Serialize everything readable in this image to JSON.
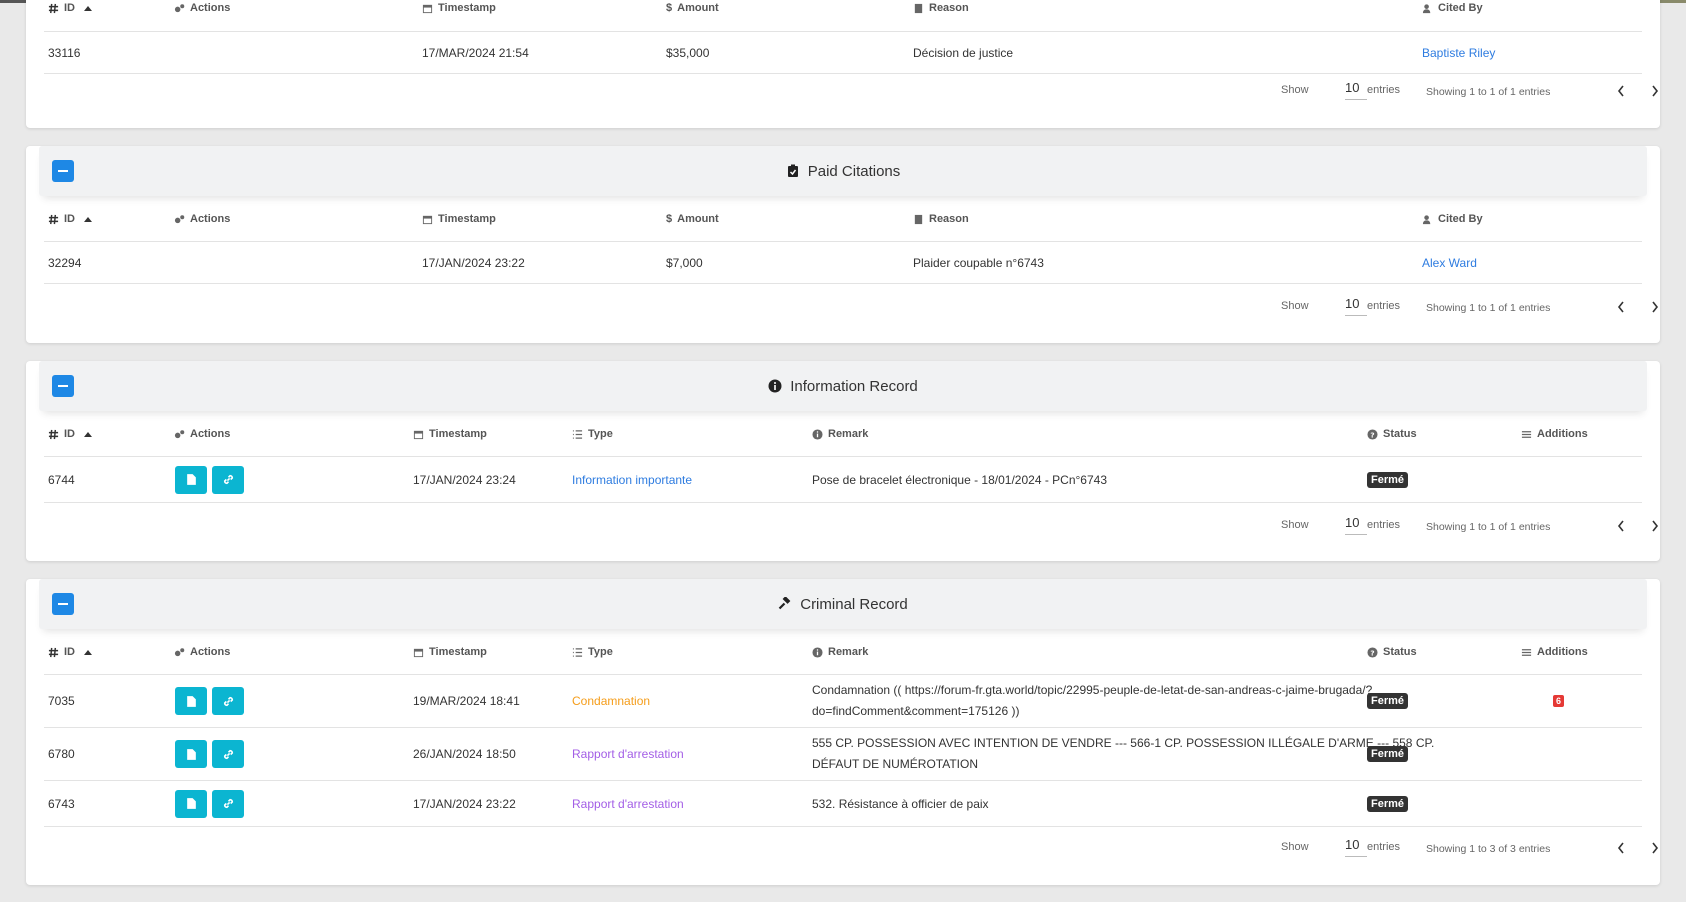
{
  "common": {
    "show_label": "Show",
    "entries_count": "10",
    "entries_label": "entries",
    "status_closed": "Fermé"
  },
  "unpaid": {
    "headers": {
      "id": "ID",
      "actions": "Actions",
      "timestamp": "Timestamp",
      "amount": "Amount",
      "reason": "Reason",
      "cited_by": "Cited By"
    },
    "rows": [
      {
        "id": "33116",
        "timestamp": "17/MAR/2024 21:54",
        "amount": "$35,000",
        "reason": "Décision de justice",
        "cited_by": "Baptiste Riley"
      }
    ],
    "info": "Showing 1 to 1 of 1 entries"
  },
  "paid": {
    "title": "Paid Citations",
    "headers": {
      "id": "ID",
      "actions": "Actions",
      "timestamp": "Timestamp",
      "amount": "Amount",
      "reason": "Reason",
      "cited_by": "Cited By"
    },
    "rows": [
      {
        "id": "32294",
        "timestamp": "17/JAN/2024 23:22",
        "amount": "$7,000",
        "reason": "Plaider coupable n°6743",
        "cited_by": "Alex Ward"
      }
    ],
    "info": "Showing 1 to 1 of 1 entries"
  },
  "information": {
    "title": "Information Record",
    "headers": {
      "id": "ID",
      "actions": "Actions",
      "timestamp": "Timestamp",
      "type": "Type",
      "remark": "Remark",
      "status": "Status",
      "additions": "Additions"
    },
    "rows": [
      {
        "id": "6744",
        "timestamp": "17/JAN/2024 23:24",
        "type": "Information importante",
        "remark": "Pose de bracelet électronique - 18/01/2024 - PCn°6743",
        "status": "Fermé"
      }
    ],
    "info": "Showing 1 to 1 of 1 entries"
  },
  "criminal": {
    "title": "Criminal Record",
    "headers": {
      "id": "ID",
      "actions": "Actions",
      "timestamp": "Timestamp",
      "type": "Type",
      "remark": "Remark",
      "status": "Status",
      "additions": "Additions"
    },
    "rows": [
      {
        "id": "7035",
        "timestamp": "19/MAR/2024 18:41",
        "type": "Condamnation",
        "remark_line1": "Condamnation (( https://forum-fr.gta.world/topic/22995-peuple-de-letat-de-san-andreas-c-jaime-brugada/?",
        "remark_line2": "do=findComment&comment=175126 ))",
        "status": "Fermé",
        "additions": "6"
      },
      {
        "id": "6780",
        "timestamp": "26/JAN/2024 18:50",
        "type": "Rapport d'arrestation",
        "remark_line1": "555 CP. POSSESSION AVEC INTENTION DE VENDRE --- 566-1 CP. POSSESSION ILLÉGALE D'ARME --- 558 CP.",
        "remark_line2": "DÉFAUT DE NUMÉROTATION",
        "status": "Fermé"
      },
      {
        "id": "6743",
        "timestamp": "17/JAN/2024 23:22",
        "type": "Rapport d'arrestation",
        "remark": "532. Résistance à officier de paix",
        "status": "Fermé"
      }
    ],
    "info": "Showing 1 to 3 of 3 entries"
  },
  "colors": {
    "primary": "#1e88e5",
    "info": "#0bb5d1",
    "link": "#2e7ce0",
    "orange": "#f59d1a",
    "purple": "#a35ee6",
    "danger": "#e53935"
  }
}
